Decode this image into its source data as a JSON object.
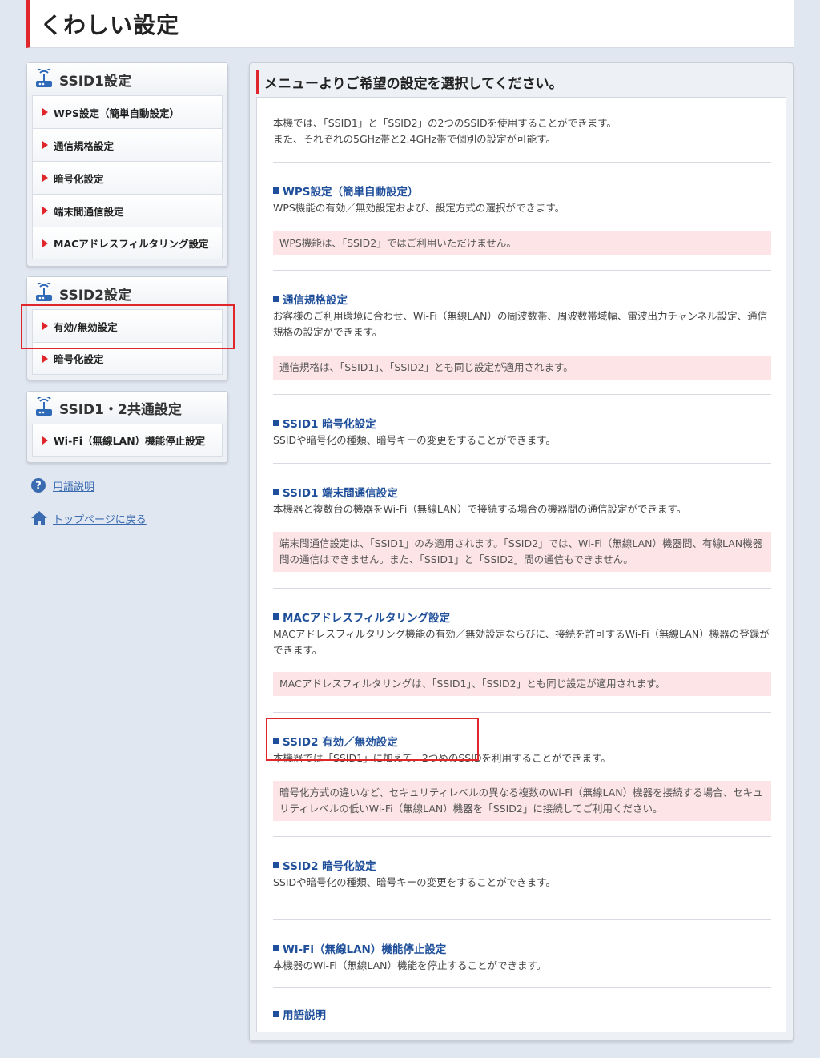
{
  "page_title": "くわしい設定",
  "sidebar": {
    "groups": [
      {
        "title": "SSID1設定",
        "items": [
          "WPS設定（簡単自動設定）",
          "通信規格設定",
          "暗号化設定",
          "端末間通信設定",
          "MACアドレスフィルタリング設定"
        ]
      },
      {
        "title": "SSID2設定",
        "items": [
          "有効/無効設定",
          "暗号化設定"
        ]
      },
      {
        "title": "SSID1・2共通設定",
        "items": [
          "Wi-Fi（無線LAN）機能停止設定"
        ]
      }
    ],
    "links": {
      "glossary": "用語説明",
      "top": "トップページに戻る"
    }
  },
  "main": {
    "heading": "メニューよりご希望の設定を選択してください。",
    "intro": [
      "本機では、「SSID1」と「SSID2」の2つのSSIDを使用することができます。",
      "また、それぞれの5GHz帯と2.4GHz帯で個別の設定が可能す。"
    ],
    "sections": [
      {
        "title": "WPS設定（簡単自動設定）",
        "desc": "WPS機能の有効／無効設定および、設定方式の選択ができます。",
        "note": "WPS機能は、「SSID2」ではご利用いただけません。"
      },
      {
        "title": "通信規格設定",
        "desc": "お客様のご利用環境に合わせ、Wi-Fi（無線LAN）の周波数帯、周波数帯域幅、電波出力チャンネル設定、通信規格の設定ができます。",
        "note": "通信規格は、「SSID1」、「SSID2」とも同じ設定が適用されます。"
      },
      {
        "title": "SSID1 暗号化設定",
        "desc": "SSIDや暗号化の種類、暗号キーの変更をすることができます。"
      },
      {
        "title": "SSID1 端末間通信設定",
        "desc": "本機器と複数台の機器をWi-Fi（無線LAN）で接続する場合の機器間の通信設定ができます。",
        "note": "端末間通信設定は、「SSID1」のみ適用されます。「SSID2」では、Wi-Fi（無線LAN）機器間、有線LAN機器間の通信はできません。また、「SSID1」と「SSID2」間の通信もできません。"
      },
      {
        "title": "MACアドレスフィルタリング設定",
        "desc": "MACアドレスフィルタリング機能の有効／無効設定ならびに、接続を許可するWi-Fi（無線LAN）機器の登録ができます。",
        "note": "MACアドレスフィルタリングは、「SSID1」、「SSID2」とも同じ設定が適用されます。"
      },
      {
        "title": "SSID2 有効／無効設定",
        "desc": "本機器では「SSID1」に加えて、2つめのSSIDを利用することができます。",
        "note": "暗号化方式の違いなど、セキュリティレベルの異なる複数のWi-Fi（無線LAN）機器を接続する場合、セキュリティレベルの低いWi-Fi（無線LAN）機器を「SSID2」に接続してご利用ください。"
      },
      {
        "title": "SSID2 暗号化設定",
        "desc": "SSIDや暗号化の種類、暗号キーの変更をすることができます。"
      },
      {
        "title": "Wi-Fi（無線LAN）機能停止設定",
        "desc": "本機器のWi-Fi（無線LAN）機能を停止することができます。"
      },
      {
        "title": "用語説明"
      }
    ]
  },
  "colors": {
    "accent": "#e0262b",
    "link": "#1f4f9a",
    "note_bg": "#fde4e7",
    "page_bg": "#e1e7f1"
  }
}
